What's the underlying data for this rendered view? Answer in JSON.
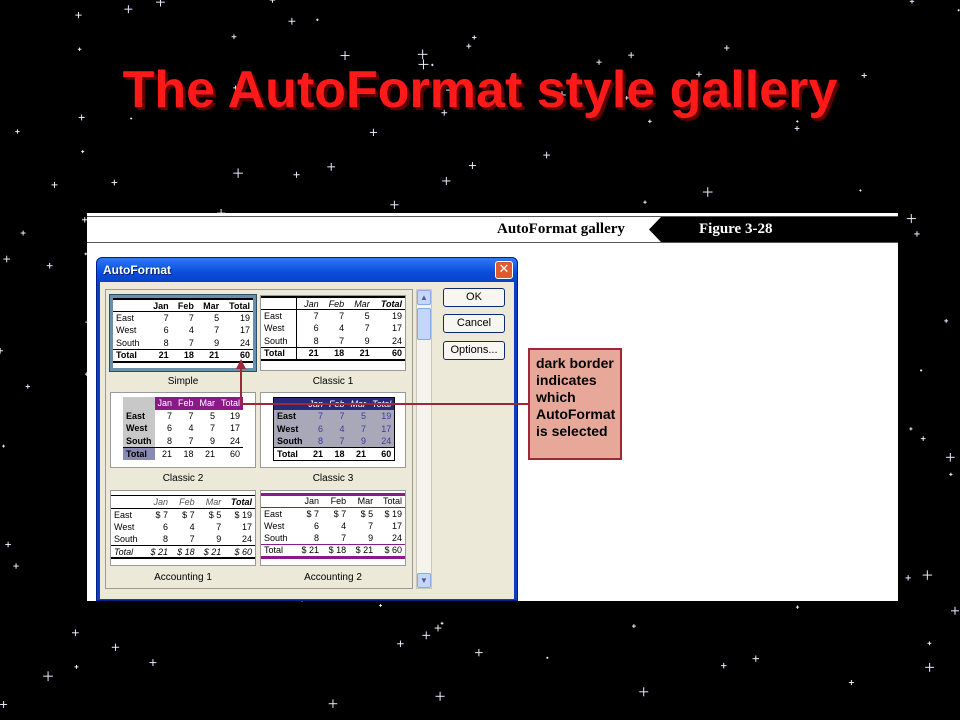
{
  "slide": {
    "title": "The AutoFormat style gallery"
  },
  "figure": {
    "caption": "AutoFormat gallery",
    "number": "Figure 3-28"
  },
  "dialog": {
    "title": "AutoFormat",
    "close_glyph": "✕",
    "buttons": {
      "ok": "OK",
      "cancel": "Cancel",
      "options": "Options..."
    },
    "scroll_up_glyph": "▲",
    "scroll_down_glyph": "▼"
  },
  "callout": {
    "text": "dark border indicates which AutoFormat is selected"
  },
  "gallery": {
    "simple": {
      "label": "Simple",
      "header": [
        "",
        "Jan",
        "Feb",
        "Mar",
        "Total"
      ],
      "rows": [
        [
          "East",
          "7",
          "7",
          "5",
          "19"
        ],
        [
          "West",
          "6",
          "4",
          "7",
          "17"
        ],
        [
          "South",
          "8",
          "7",
          "9",
          "24"
        ]
      ],
      "total": [
        "Total",
        "21",
        "18",
        "21",
        "60"
      ]
    },
    "classic1": {
      "label": "Classic 1",
      "header": [
        "",
        "Jan",
        "Feb",
        "Mar",
        "Total"
      ],
      "rows": [
        [
          "East",
          "7",
          "7",
          "5",
          "19"
        ],
        [
          "West",
          "6",
          "4",
          "7",
          "17"
        ],
        [
          "South",
          "8",
          "7",
          "9",
          "24"
        ]
      ],
      "total": [
        "Total",
        "21",
        "18",
        "21",
        "60"
      ]
    },
    "classic2": {
      "label": "Classic 2",
      "header": [
        "",
        "Jan",
        "Feb",
        "Mar",
        "Total"
      ],
      "rows": [
        [
          "East",
          "7",
          "7",
          "5",
          "19"
        ],
        [
          "West",
          "6",
          "4",
          "7",
          "17"
        ],
        [
          "South",
          "8",
          "7",
          "9",
          "24"
        ]
      ],
      "total": [
        "Total",
        "21",
        "18",
        "21",
        "60"
      ]
    },
    "classic3": {
      "label": "Classic 3",
      "header": [
        "",
        "Jan",
        "Feb",
        "Mar",
        "Total"
      ],
      "rows": [
        [
          "East",
          "7",
          "7",
          "5",
          "19"
        ],
        [
          "West",
          "6",
          "4",
          "7",
          "17"
        ],
        [
          "South",
          "8",
          "7",
          "9",
          "24"
        ]
      ],
      "total": [
        "Total",
        "21",
        "18",
        "21",
        "60"
      ]
    },
    "accounting1": {
      "label": "Accounting 1",
      "header": [
        "",
        "Jan",
        "Feb",
        "Mar",
        "Total"
      ],
      "rows": [
        [
          "East",
          "$ 7",
          "$ 7",
          "$ 5",
          "$ 19"
        ],
        [
          "West",
          "6",
          "4",
          "7",
          "17"
        ],
        [
          "South",
          "8",
          "7",
          "9",
          "24"
        ]
      ],
      "total": [
        "Total",
        "$ 21",
        "$ 18",
        "$ 21",
        "$ 60"
      ]
    },
    "accounting2": {
      "label": "Accounting 2",
      "header": [
        "",
        "Jan",
        "Feb",
        "Mar",
        "Total"
      ],
      "rows": [
        [
          "East",
          "$ 7",
          "$ 7",
          "$ 5",
          "$ 19"
        ],
        [
          "West",
          "6",
          "4",
          "7",
          "17"
        ],
        [
          "South",
          "8",
          "7",
          "9",
          "24"
        ]
      ],
      "total": [
        "Total",
        "$ 21",
        "$ 18",
        "$ 21",
        "$ 60"
      ]
    }
  },
  "colors": {
    "title": "#ff1a1a",
    "callout_fill": "#e7a89a",
    "callout_border": "#9a2a3a",
    "dialog_title_blue": "#0a4ddb"
  }
}
